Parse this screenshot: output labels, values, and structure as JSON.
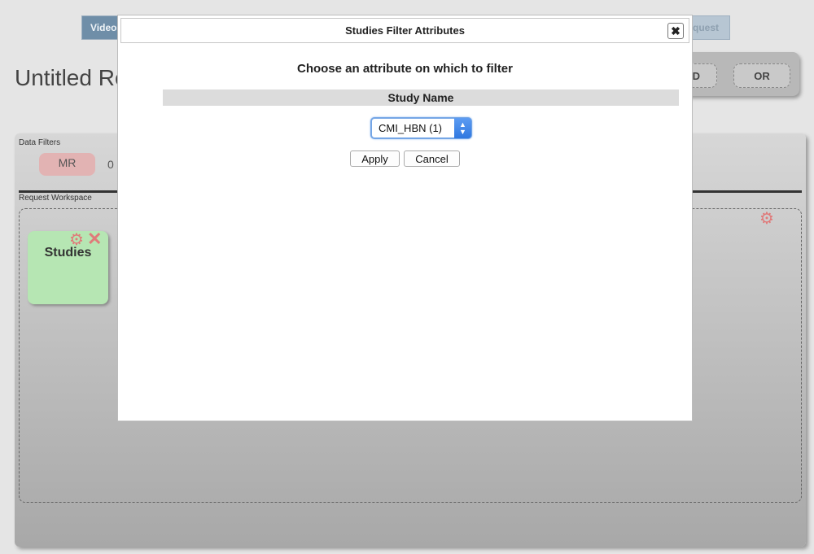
{
  "top_nav": {
    "left_button": "Video",
    "right_button": "quest"
  },
  "page": {
    "title": "Untitled Re"
  },
  "operators": {
    "and_label": "D",
    "or_label": "OR"
  },
  "workspace": {
    "data_filters_label": "Data Filters",
    "mr_chip": "MR",
    "mr_count": "0",
    "request_workspace_label": "Request Workspace",
    "studies_card_title": "Studies"
  },
  "dialog": {
    "title": "Studies Filter Attributes",
    "close_glyph": "✖",
    "heading": "Choose an attribute on which to filter",
    "attribute_header": "Study Name",
    "select_value": "CMI_HBN (1)",
    "apply_label": "Apply",
    "cancel_label": "Cancel"
  },
  "colors": {
    "accent_select": "#2f78e0",
    "studies_card": "#b6e6b3",
    "filter_chip": "#e2b3b3",
    "remove_icon": "#e07a7a"
  }
}
